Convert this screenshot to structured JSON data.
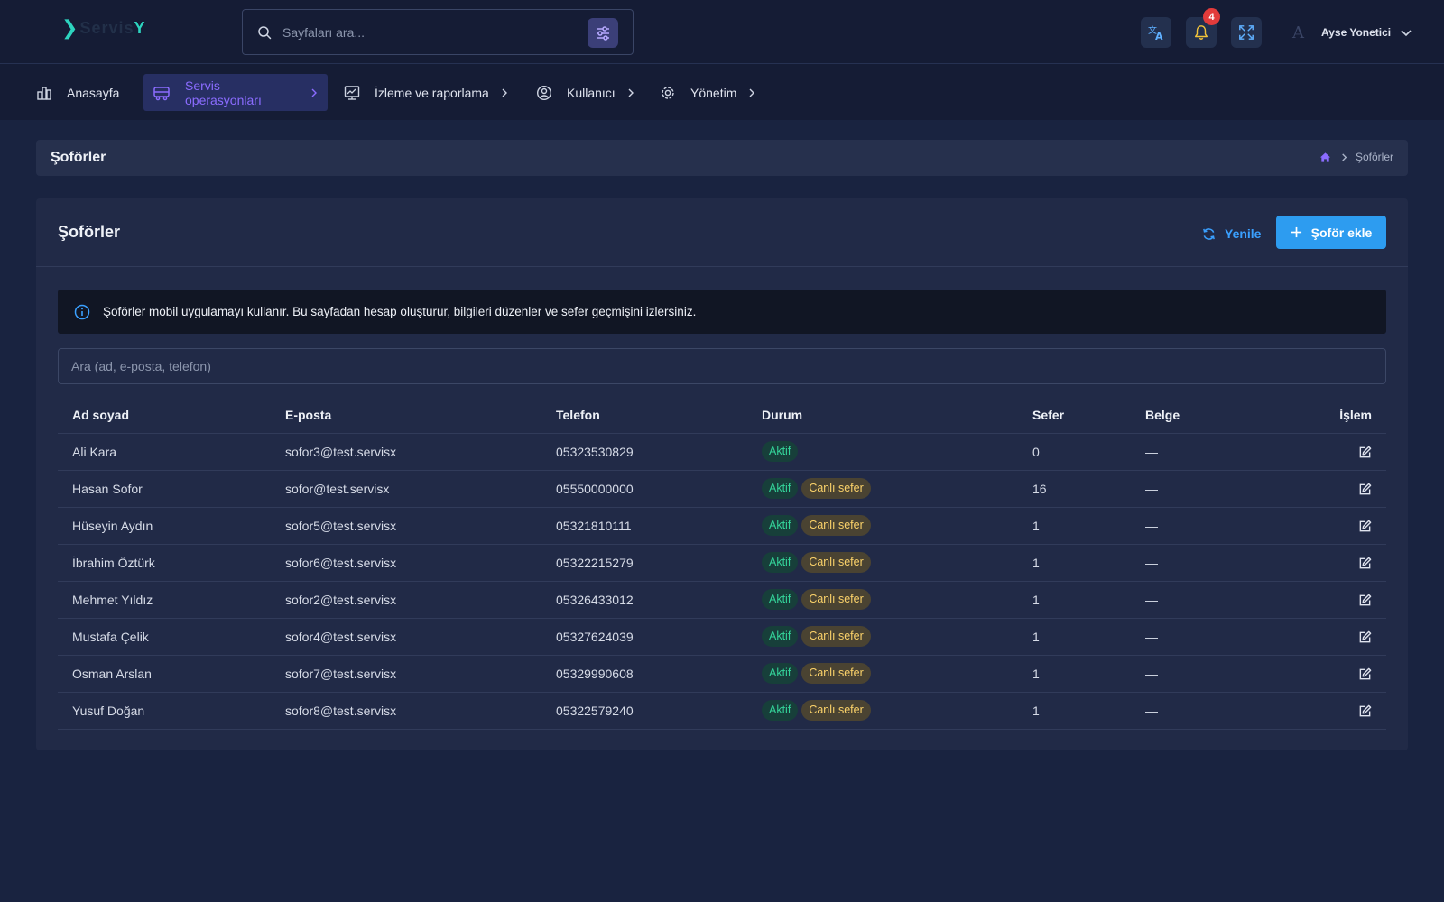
{
  "header": {
    "logo_text": "Servis",
    "logo_suffix": "Y",
    "search_placeholder": "Sayfaları ara...",
    "notification_count": "4",
    "user_initial": "A",
    "user_name": "Ayse Yonetici"
  },
  "nav": {
    "items": [
      {
        "label": "Anasayfa"
      },
      {
        "label": "Servis operasyonları"
      },
      {
        "label": "İzleme ve raporlama"
      },
      {
        "label": "Kullanıcı"
      },
      {
        "label": "Yönetim"
      }
    ]
  },
  "page": {
    "title": "Şoförler",
    "breadcrumb_current": "Şoförler"
  },
  "card": {
    "title": "Şoförler",
    "refresh_label": "Yenile",
    "add_label": "Şoför ekle",
    "info_text": "Şoförler mobil uygulamayı kullanır. Bu sayfadan hesap oluşturur, bilgileri düzenler ve sefer geçmişini izlersiniz.",
    "search_placeholder": "Ara (ad, e-posta, telefon)"
  },
  "table": {
    "columns": [
      "Ad soyad",
      "E-posta",
      "Telefon",
      "Durum",
      "Sefer",
      "Belge",
      "İşlem"
    ],
    "status_active": "Aktif",
    "status_live": "Canlı sefer",
    "rows": [
      {
        "name": "Ali Kara",
        "email": "sofor3@test.servisx",
        "phone": "05323530829",
        "live": false,
        "trips": "0",
        "doc": "—"
      },
      {
        "name": "Hasan Sofor",
        "email": "sofor@test.servisx",
        "phone": "05550000000",
        "live": true,
        "trips": "16",
        "doc": "—"
      },
      {
        "name": "Hüseyin Aydın",
        "email": "sofor5@test.servisx",
        "phone": "05321810111",
        "live": true,
        "trips": "1",
        "doc": "—"
      },
      {
        "name": "İbrahim Öztürk",
        "email": "sofor6@test.servisx",
        "phone": "05322215279",
        "live": true,
        "trips": "1",
        "doc": "—"
      },
      {
        "name": "Mehmet Yıldız",
        "email": "sofor2@test.servisx",
        "phone": "05326433012",
        "live": true,
        "trips": "1",
        "doc": "—"
      },
      {
        "name": "Mustafa Çelik",
        "email": "sofor4@test.servisx",
        "phone": "05327624039",
        "live": true,
        "trips": "1",
        "doc": "—"
      },
      {
        "name": "Osman Arslan",
        "email": "sofor7@test.servisx",
        "phone": "05329990608",
        "live": true,
        "trips": "1",
        "doc": "—"
      },
      {
        "name": "Yusuf Doğan",
        "email": "sofor8@test.servisx",
        "phone": "05322579240",
        "live": true,
        "trips": "1",
        "doc": "—"
      }
    ]
  },
  "colors": {
    "background": "#192340",
    "accent": "#8b6cff",
    "primary_button": "#2d9cf0",
    "active_badge": "#34d399",
    "live_badge": "#fbd26a"
  }
}
